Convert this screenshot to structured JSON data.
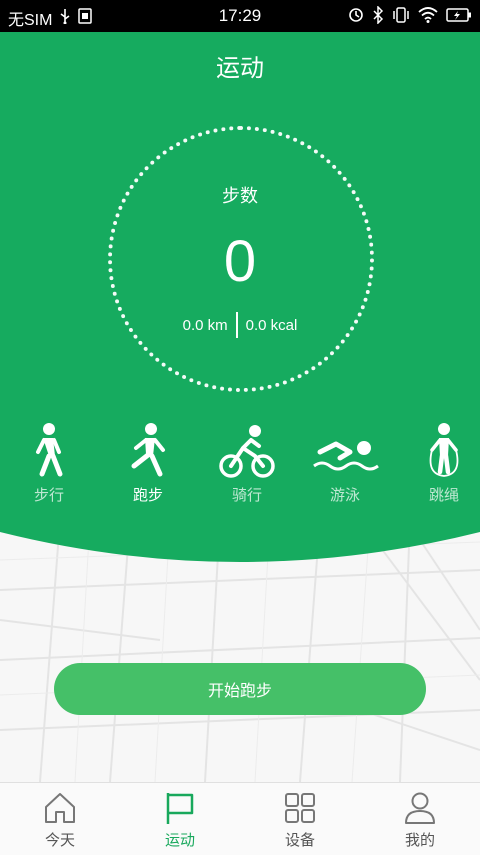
{
  "status_bar": {
    "carrier": "无SIM",
    "time": "17:29"
  },
  "header": {
    "title": "运动"
  },
  "summary": {
    "steps_label": "步数",
    "steps_value": "0",
    "distance": "0.0 km",
    "calories": "0.0 kcal"
  },
  "sports": [
    {
      "id": "walk",
      "label": "步行",
      "icon": "walking-icon",
      "active": false
    },
    {
      "id": "run",
      "label": "跑步",
      "icon": "running-icon",
      "active": true
    },
    {
      "id": "ride",
      "label": "骑行",
      "icon": "cycling-icon",
      "active": false
    },
    {
      "id": "swim",
      "label": "游泳",
      "icon": "swimming-icon",
      "active": false
    },
    {
      "id": "rope",
      "label": "跳绳",
      "icon": "jump-rope-icon",
      "active": false
    }
  ],
  "start_button": {
    "label": "开始跑步"
  },
  "tabbar": [
    {
      "label": "今天",
      "icon": "home-icon",
      "active": false
    },
    {
      "label": "运动",
      "icon": "flag-icon",
      "active": true
    },
    {
      "label": "设备",
      "icon": "grid-icon",
      "active": false
    },
    {
      "label": "我的",
      "icon": "person-icon",
      "active": false
    }
  ],
  "colors": {
    "primary_green": "#16ab5f",
    "button_green": "#45c068",
    "tab_active": "#18a85c",
    "tab_inactive": "#555555"
  }
}
